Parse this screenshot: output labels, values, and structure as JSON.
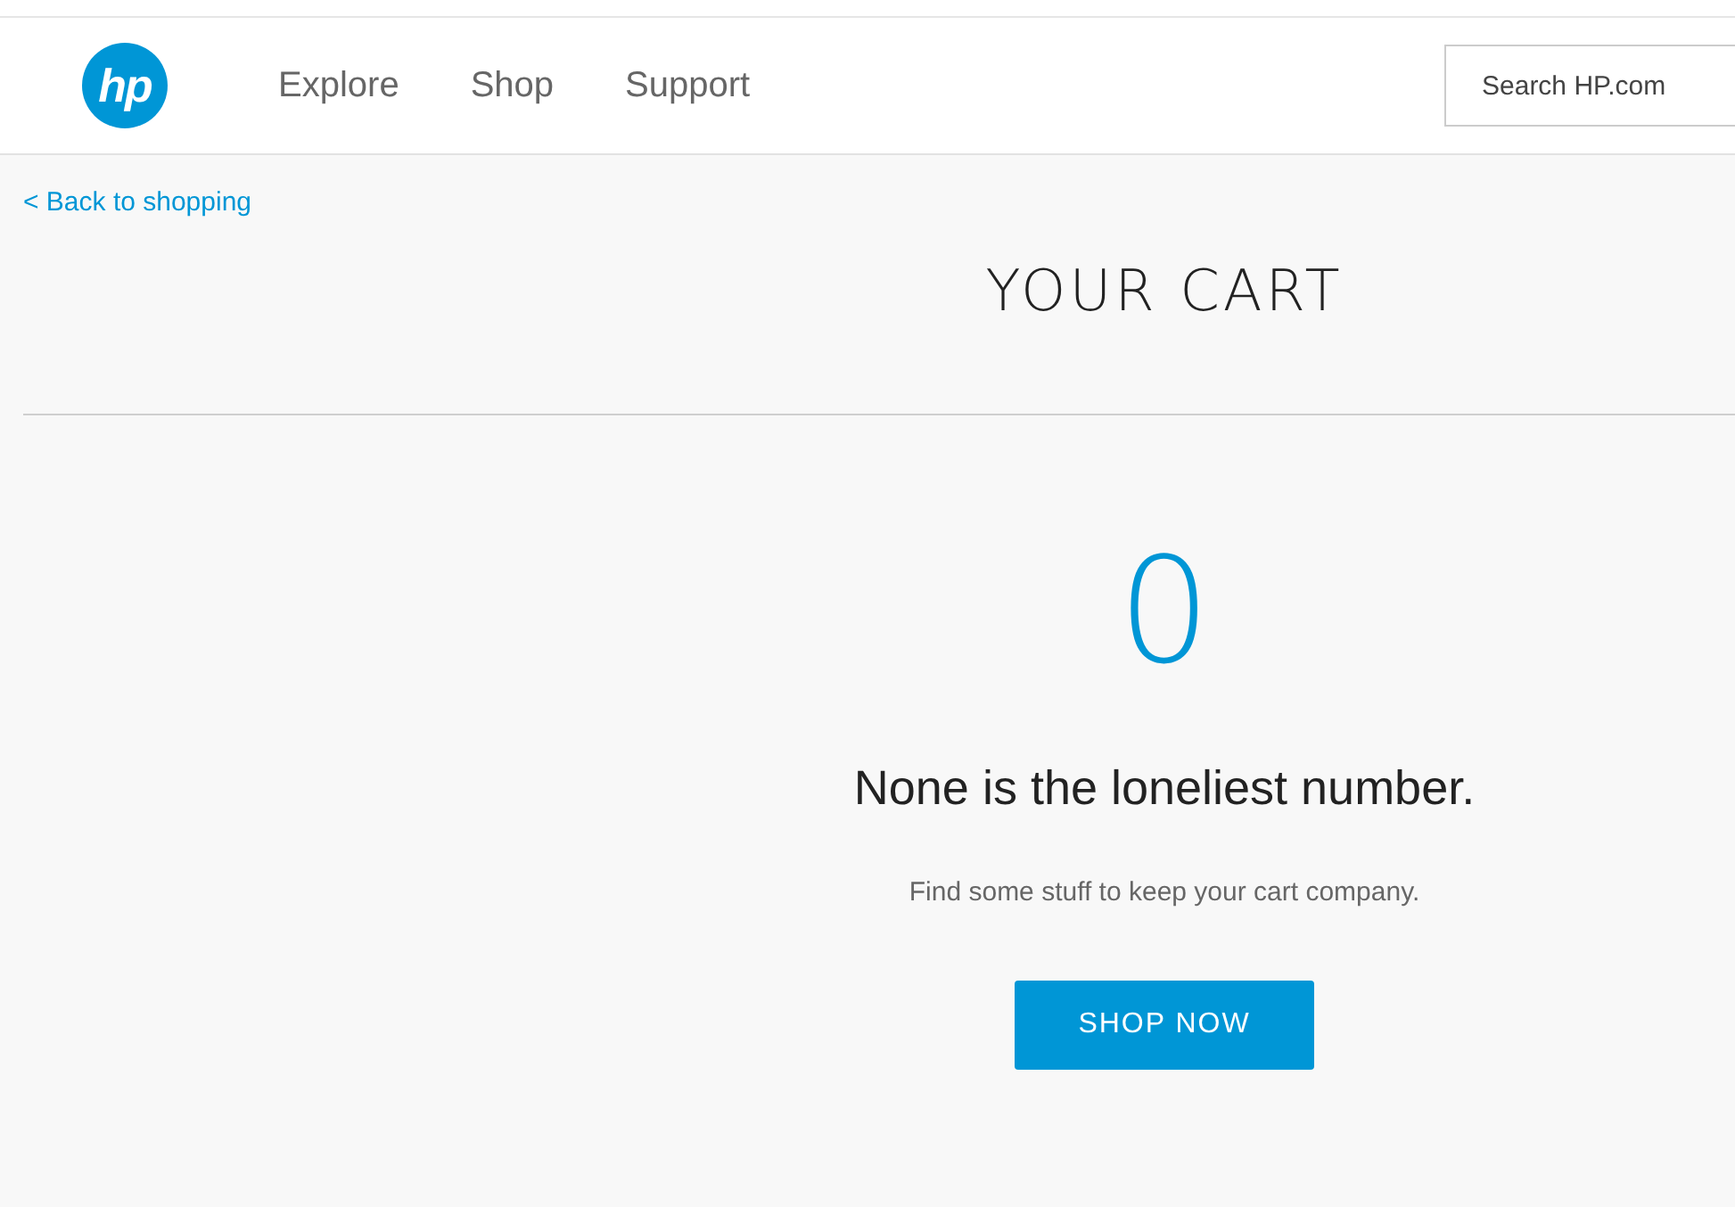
{
  "header": {
    "logo": "hp",
    "nav": [
      {
        "label": "Explore"
      },
      {
        "label": "Shop"
      },
      {
        "label": "Support"
      }
    ],
    "search": {
      "placeholder": "Search HP.com"
    }
  },
  "back_link": "< Back to shopping",
  "title": "YOUR CART",
  "cart": {
    "count": "0",
    "headline": "None is the loneliest number.",
    "message": "Find some stuff to keep your cart company.",
    "button": "SHOP NOW"
  }
}
